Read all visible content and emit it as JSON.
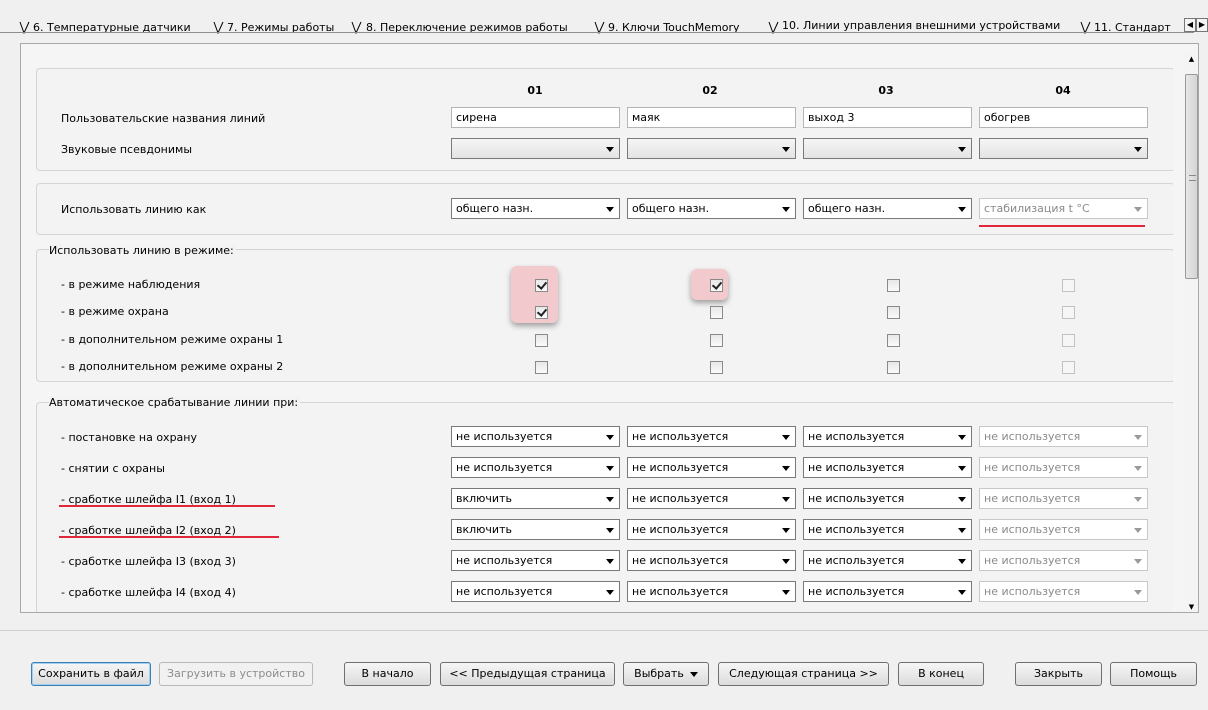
{
  "tabs": [
    {
      "label": "6. Температурные датчики"
    },
    {
      "label": "7. Режимы работы"
    },
    {
      "label": "8. Переключение режимов работы"
    },
    {
      "label": "9. Ключи TouchMemory"
    },
    {
      "label": "10. Линии управления внешними устройствами",
      "active": true
    },
    {
      "label": "11. Стандарт"
    }
  ],
  "columns": [
    "01",
    "02",
    "03",
    "04"
  ],
  "rows": {
    "user_names": "Пользовательские названия линий",
    "sound_aliases": "Звуковые псевдонимы",
    "use_as": "Использовать линию как"
  },
  "line_names": [
    "сирена",
    "маяк",
    "выход 3",
    "обогрев"
  ],
  "use_as_values": [
    "общего назн.",
    "общего назн.",
    "общего назн.",
    "стабилизация t °C"
  ],
  "mode_group": {
    "title": "Использовать линию в режиме:",
    "rows": [
      {
        "label": "- в режиме наблюдения",
        "checked": [
          true,
          true,
          false,
          false
        ]
      },
      {
        "label": "- в режиме охрана",
        "checked": [
          true,
          false,
          false,
          false
        ]
      },
      {
        "label": "- в дополнительном режиме охраны 1",
        "checked": [
          false,
          false,
          false,
          false
        ]
      },
      {
        "label": "- в дополнительном режиме охраны 2",
        "checked": [
          false,
          false,
          false,
          false
        ]
      }
    ]
  },
  "auto_group": {
    "title": "Автоматическое срабатывание линии при:",
    "rows": [
      {
        "label": "- постановке на охрану",
        "values": [
          "не используется",
          "не используется",
          "не используется",
          "не используется"
        ]
      },
      {
        "label": "- снятии с охраны",
        "values": [
          "не используется",
          "не используется",
          "не используется",
          "не используется"
        ]
      },
      {
        "label": "- сработке шлейфа I1 (вход 1)",
        "values": [
          "включить",
          "не используется",
          "не используется",
          "не используется"
        ]
      },
      {
        "label": "- сработке шлейфа I2 (вход 2)",
        "values": [
          "включить",
          "не используется",
          "не используется",
          "не используется"
        ]
      },
      {
        "label": "- сработке шлейфа I3 (вход 3)",
        "values": [
          "не используется",
          "не используется",
          "не используется",
          "не используется"
        ]
      },
      {
        "label": "- сработке шлейфа I4 (вход 4)",
        "values": [
          "не используется",
          "не используется",
          "не используется",
          "не используется"
        ]
      }
    ]
  },
  "buttons": {
    "save_file": "Сохранить в файл",
    "load_device": "Загрузить в устройство",
    "to_start": "В начало",
    "prev_page": "<< Предыдущая страница",
    "select": "Выбрать",
    "next_page": "Следующая страница >>",
    "to_end": "В конец",
    "close": "Закрыть",
    "help": "Помощь"
  },
  "colors": {
    "highlight": "#f2c9cc",
    "underline": "#e0283a",
    "accent": "#3c7fb1"
  }
}
